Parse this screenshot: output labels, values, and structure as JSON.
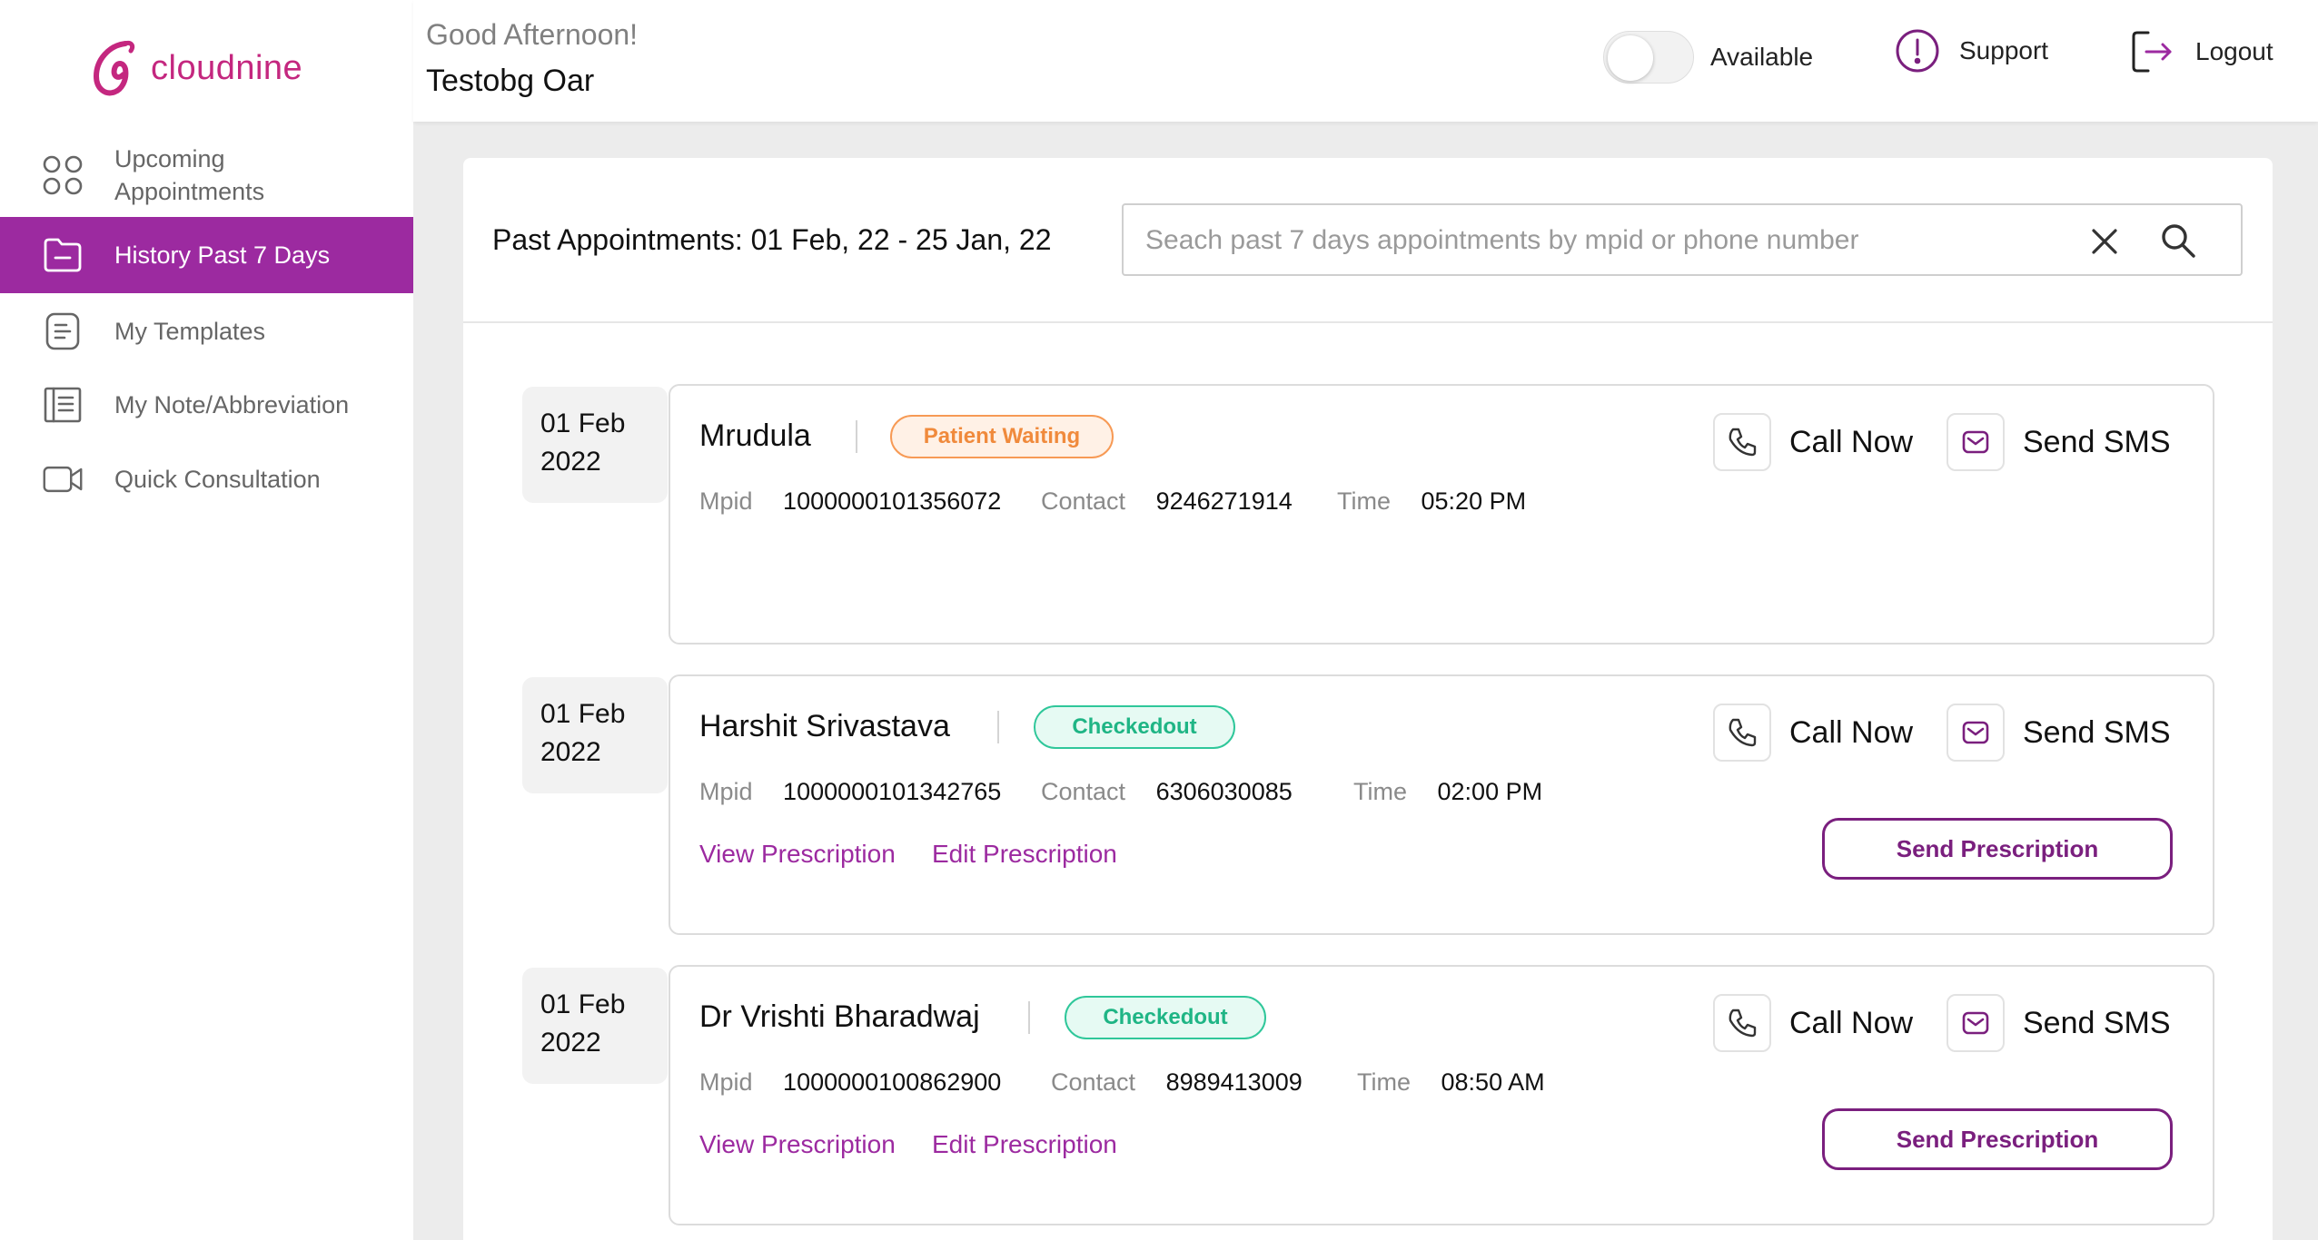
{
  "brand": {
    "name": "cloudnine"
  },
  "sidebar": {
    "items": [
      {
        "label": "Upcoming Appointments",
        "line1": "Upcoming",
        "line2": "Appointments",
        "icon": "grid-icon",
        "active": false
      },
      {
        "label": "History Past 7 Days",
        "icon": "folder-icon",
        "active": true
      },
      {
        "label": "My Templates",
        "icon": "document-icon",
        "active": false
      },
      {
        "label": "My Note/Abbreviation",
        "icon": "notebook-icon",
        "active": false
      },
      {
        "label": "Quick Consultation",
        "icon": "video-icon",
        "active": false
      }
    ]
  },
  "header": {
    "greeting": "Good Afternoon!",
    "user_name": "Testobg Oar",
    "availability_label": "Available",
    "availability_on": false,
    "support_label": "Support",
    "logout_label": "Logout"
  },
  "main": {
    "title": "Past Appointments: 01 Feb, 22 - 25 Jan, 22",
    "search": {
      "placeholder": "Seach past 7 days appointments by mpid or phone number",
      "value": ""
    },
    "field_labels": {
      "mpid": "Mpid",
      "contact": "Contact",
      "time": "Time"
    },
    "action_labels": {
      "call": "Call Now",
      "sms": "Send SMS",
      "view_prescription": "View Prescription",
      "edit_prescription": "Edit Prescription",
      "send_prescription": "Send Prescription"
    },
    "appointments": [
      {
        "date_line1": "01 Feb",
        "date_line2": "2022",
        "name": "Mrudula",
        "status": "Patient Waiting",
        "mpid": "1000000101356072",
        "contact": "9246271914",
        "time": "05:20 PM"
      },
      {
        "date_line1": "01 Feb",
        "date_line2": "2022",
        "name": "Harshit Srivastava",
        "status": "Checkedout",
        "mpid": "1000000101342765",
        "contact": "6306030085",
        "time": "02:00 PM"
      },
      {
        "date_line1": "01 Feb",
        "date_line2": "2022",
        "name": "Dr Vrishti Bharadwaj",
        "status": "Checkedout",
        "mpid": "1000000100862900",
        "contact": "8989413009",
        "time": "08:50 AM"
      }
    ]
  },
  "colors": {
    "brand": "#c4277f",
    "accent": "#9c2aa0",
    "accent_dark": "#7a1f7e",
    "waiting": "#f08a3c",
    "checkedout": "#1fb585"
  }
}
